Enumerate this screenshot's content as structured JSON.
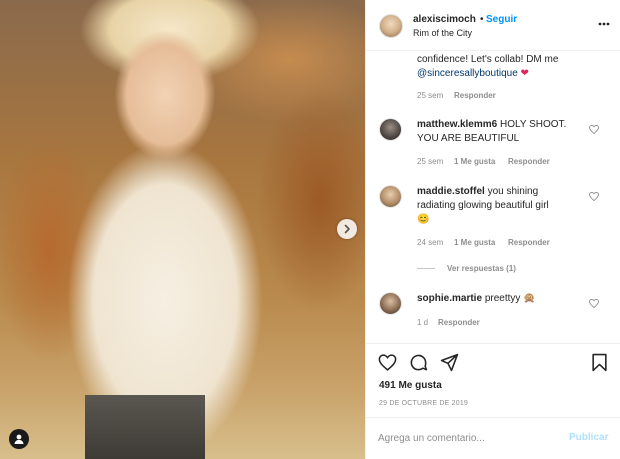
{
  "post": {
    "username": "alexiscimoch",
    "follow_label": "Seguir",
    "location": "Rim of the City",
    "dot": "•"
  },
  "comments": {
    "first_partial": {
      "line1": "confidence! Let's collab! DM me",
      "mention": "@sinceresallyboutique",
      "emoji": "❤",
      "time": "25 sem",
      "reply": "Responder"
    },
    "c2": {
      "user": "matthew.klemm6",
      "text_line1": "HOLY SHOOT.",
      "text_line2": "YOU ARE BEAUTIFUL",
      "time": "25 sem",
      "likes": "1 Me gusta",
      "reply": "Responder"
    },
    "c3": {
      "user": "maddie.stoffel",
      "text_line1": "you shining",
      "text_line2": "radiating glowing beautiful girl",
      "emoji": "😊",
      "time": "24 sem",
      "likes": "1 Me gusta",
      "reply": "Responder",
      "view_replies": "Ver respuestas (1)"
    },
    "c4": {
      "user": "sophie.martie",
      "text": "preettyy",
      "emoji": "🙊",
      "time": "1 d",
      "reply": "Responder"
    }
  },
  "actions": {
    "likes": "491 Me gusta",
    "date": "29 DE OCTUBRE DE 2019"
  },
  "add_comment": {
    "placeholder": "Agrega un comentario...",
    "post_label": "Publicar"
  },
  "icons": {
    "like": "heart-icon",
    "comment": "comment-icon",
    "share": "share-icon",
    "save": "bookmark-icon",
    "more": "more-icon",
    "next": "chevron-right-icon",
    "tag": "user-tag-icon"
  },
  "colors": {
    "accent": "#0095f6",
    "post_disabled": "#b2dffc",
    "muted": "#8e8e8e"
  }
}
